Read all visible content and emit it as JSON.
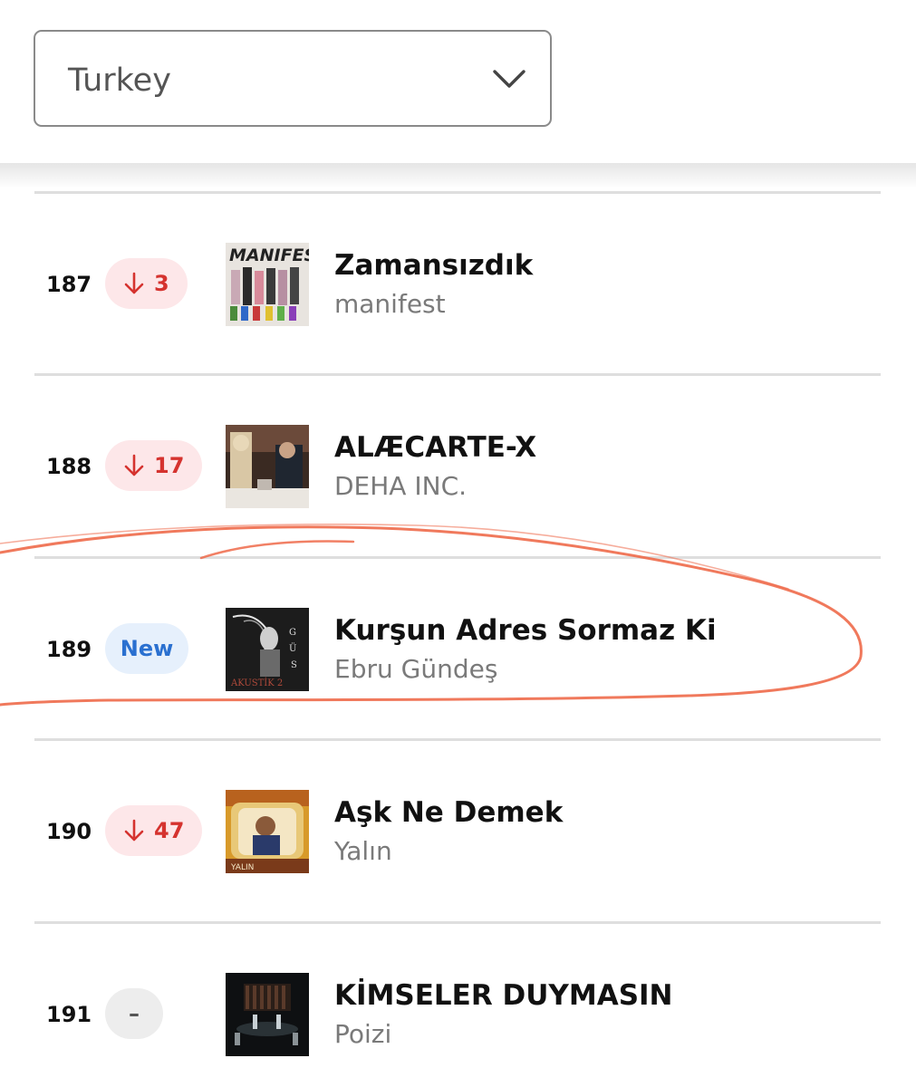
{
  "country_select": {
    "value": "Turkey",
    "chevron_icon": "chevron-down-icon"
  },
  "colors": {
    "down_text": "#d5332f",
    "down_bg": "#fde7e9",
    "new_text": "#2a70d0",
    "new_bg": "#e6f0fc",
    "same_bg": "#ededed",
    "annotation": "#ee6a4a"
  },
  "rows": [
    {
      "rank": "187",
      "change": {
        "type": "down",
        "text": "3",
        "icon": "arrow-down-icon"
      },
      "title": "Zamansızdık",
      "artist": "manifest"
    },
    {
      "rank": "188",
      "change": {
        "type": "down",
        "text": "17",
        "icon": "arrow-down-icon"
      },
      "title": "ALÆCARTE-X",
      "artist": "DEHA INC."
    },
    {
      "rank": "189",
      "change": {
        "type": "new",
        "text": "New"
      },
      "title": "Kurşun Adres Sormaz Ki",
      "artist": "Ebru Gündeş"
    },
    {
      "rank": "190",
      "change": {
        "type": "down",
        "text": "47",
        "icon": "arrow-down-icon"
      },
      "title": "Aşk Ne Demek",
      "artist": "Yalın"
    },
    {
      "rank": "191",
      "change": {
        "type": "same",
        "text": "–"
      },
      "title": "KİMSELER DUYMASIN",
      "artist": "Poizi"
    }
  ]
}
